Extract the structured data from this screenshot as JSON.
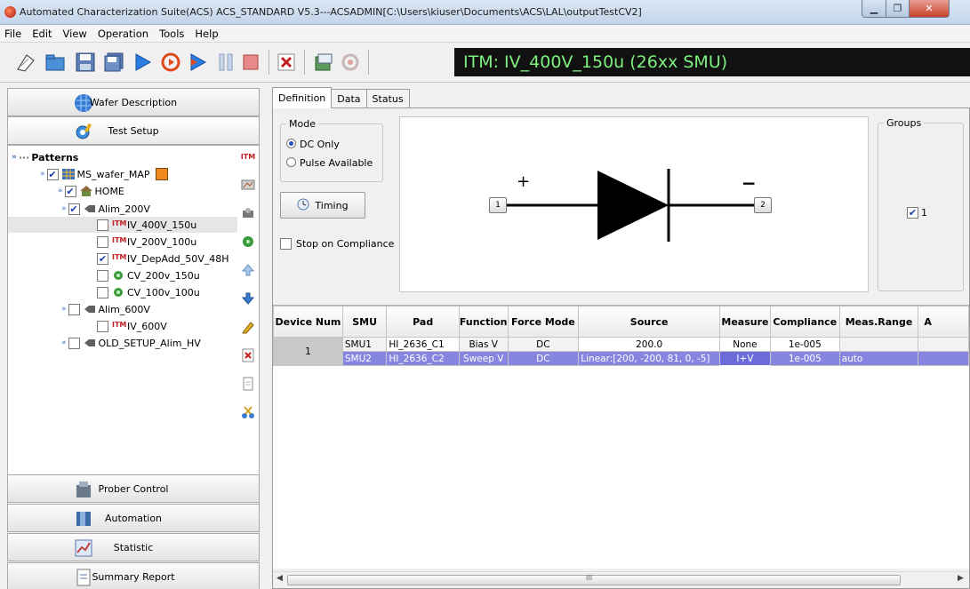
{
  "window": {
    "title": "Automated Characterization Suite(ACS) ACS_STANDARD V5.3---ACSADMIN[C:\\Users\\kiuser\\Documents\\ACS\\LAL\\outputTestCV2]"
  },
  "menu": [
    "File",
    "Edit",
    "View",
    "Operation",
    "Tools",
    "Help"
  ],
  "itm_label": "ITM: IV_400V_150u (26xx SMU)",
  "nav": {
    "wafer": "Wafer Description",
    "test_setup": "Test Setup",
    "prober": "Prober Control",
    "automation": "Automation",
    "statistic": "Statistic",
    "summary": "Summary Report"
  },
  "tree": {
    "patterns": "Patterns",
    "wafer_map": "MS_wafer_MAP",
    "home": "HOME",
    "alim200": "Alim_200V",
    "iv400": "IV_400V_150u",
    "iv200": "IV_200V_100u",
    "ivdep": "IV_DepAdd_50V_48H",
    "cv200": "CV_200v_150u",
    "cv100": "CV_100v_100u",
    "alim600": "Alim_600V",
    "iv600": "IV_600V",
    "oldsetup": "OLD_SETUP_Alim_HV"
  },
  "tabs": [
    "Definition",
    "Data",
    "Status"
  ],
  "mode": {
    "title": "Mode",
    "dc_only": "DC Only",
    "pulse": "Pulse Available",
    "timing": "Timing",
    "stop_on_compliance": "Stop on Compliance"
  },
  "diagram": {
    "plus": "+",
    "minus": "−",
    "pad1": "1",
    "pad2": "2"
  },
  "groups": {
    "title": "Groups",
    "item": "1"
  },
  "table": {
    "headers": [
      "Device Num",
      "SMU",
      "Pad",
      "Function",
      "Force Mode",
      "Source",
      "Measure",
      "Compliance",
      "Meas.Range",
      "A"
    ],
    "device_num": "1",
    "rows": [
      {
        "smu": "SMU1",
        "pad": "HI_2636_C1",
        "function": "Bias V",
        "force": "DC",
        "source": "200.0",
        "measure": "None",
        "compliance": "1e-005",
        "range": ""
      },
      {
        "smu": "SMU2",
        "pad": "HI_2636_C2",
        "function": "Sweep V",
        "force": "DC",
        "source": "Linear:[200, -200, 81, 0, -5]",
        "measure": "I+V",
        "compliance": "1e-005",
        "range": "auto"
      }
    ]
  },
  "scroll": {
    "mark": "III"
  },
  "colors": {
    "accent": "#8686e0",
    "itm_bg": "#111111",
    "itm_fg": "#7df07d"
  }
}
